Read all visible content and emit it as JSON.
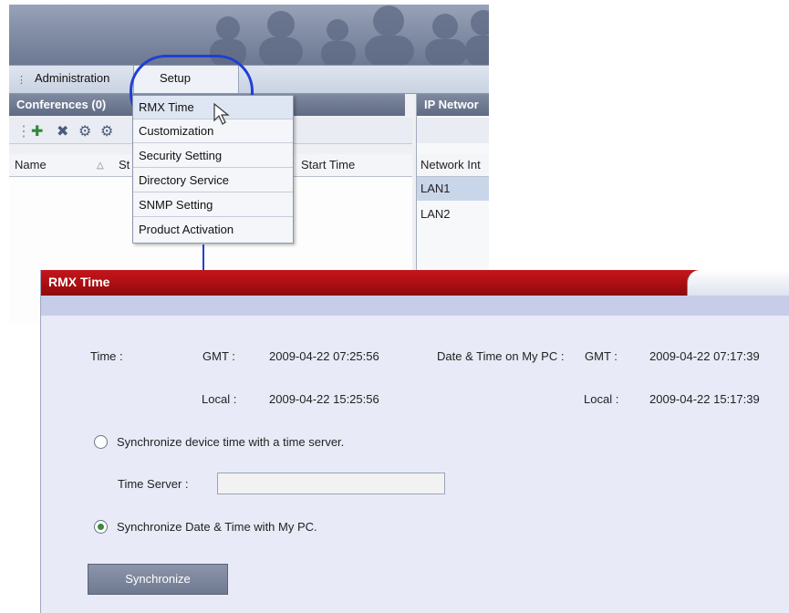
{
  "menu": {
    "administration": "Administration",
    "setup": "Setup"
  },
  "panels": {
    "conferences_title": "Conferences (0)",
    "ip_network_title": "IP Networ"
  },
  "toolbar_icons": [
    "add-conference-icon",
    "delete-icon",
    "conference-settings-icon",
    "more-icon"
  ],
  "columns": {
    "name": "Name",
    "status": "St",
    "start_time": "Start Time",
    "network_interface": "Network Int"
  },
  "ip_list": [
    "LAN1",
    "LAN2"
  ],
  "setup_menu": {
    "items": [
      "RMX Time",
      "Customization",
      "Security Setting",
      "Directory Service",
      "SNMP Setting",
      "Product Activation"
    ],
    "hovered": "RMX Time"
  },
  "dialog": {
    "title": "RMX Time",
    "time_label": "Time :",
    "gmt_label": "GMT :",
    "local_label": "Local :",
    "device_gmt": "2009-04-22 07:25:56",
    "device_local": "2009-04-22 15:25:56",
    "pc_label": "Date & Time on My PC :",
    "pc_gmt_label": "GMT :",
    "pc_local_label": "Local :",
    "pc_gmt": "2009-04-22 07:17:39",
    "pc_local": "2009-04-22 15:17:39",
    "option_server": "Synchronize device time with a time server.",
    "time_server_label": "Time Server :",
    "time_server_value": "",
    "option_pc": "Synchronize Date & Time with My PC.",
    "selected_option": "pc",
    "sync_button": "Synchronize"
  },
  "colors": {
    "dialog_title_bg": "#b3111a",
    "highlight": "#1f3fd6",
    "dialog_bg": "#e8ebf7"
  }
}
